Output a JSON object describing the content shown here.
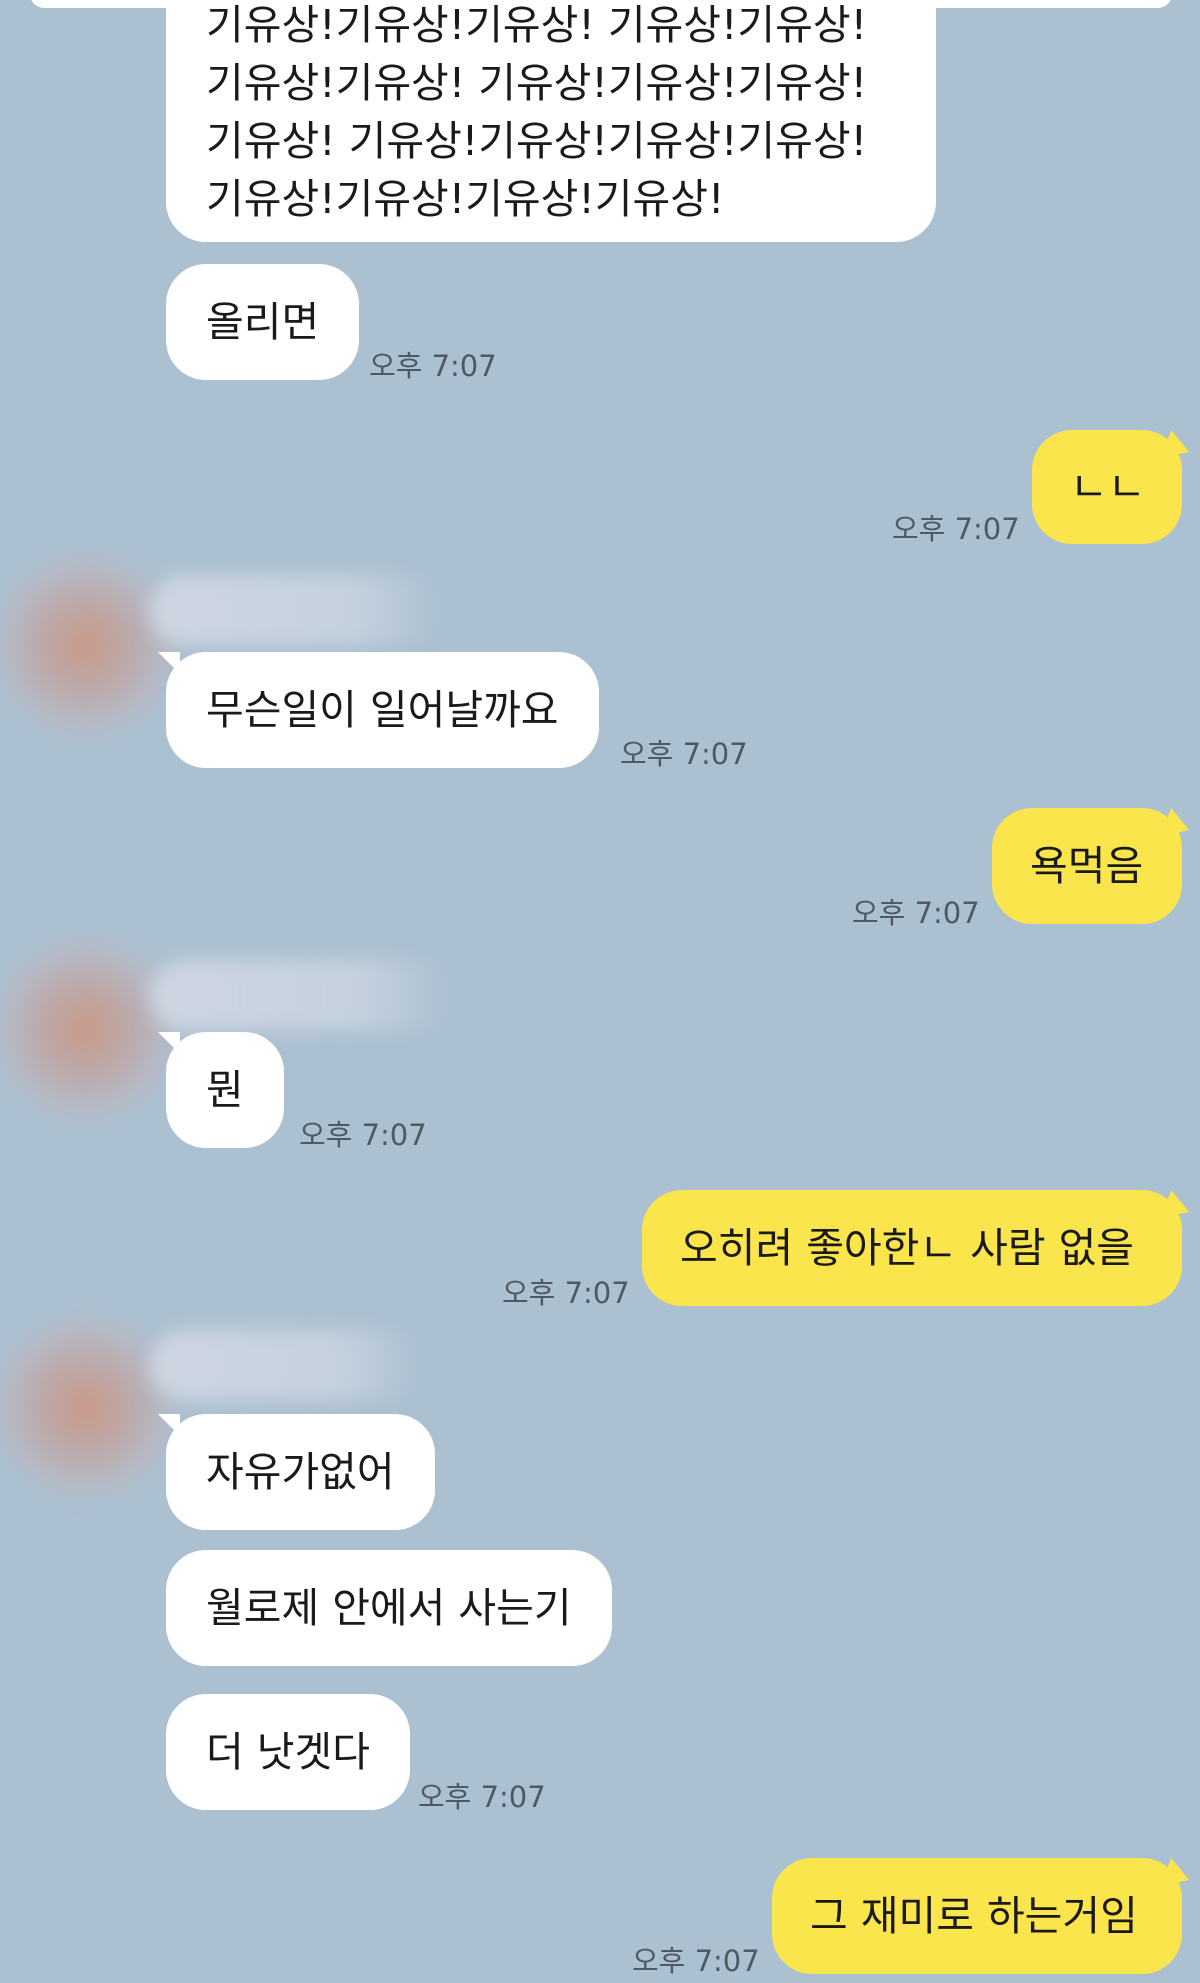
{
  "chat": {
    "messages": [
      {
        "id": "m1",
        "side": "received",
        "lines": [
          "기유상!기유상!기유상! 기유상!기유상!",
          "기유상!기유상! 기유상!기유상!기유상!",
          "기유상! 기유상!기유상!기유상!기유상!",
          "기유상!기유상!기유상!기유상!"
        ]
      },
      {
        "id": "m2",
        "side": "received",
        "text": "올리면",
        "time": "오후 7:07"
      },
      {
        "id": "m3",
        "side": "sent",
        "text": "ㄴㄴ",
        "time": "오후 7:07"
      },
      {
        "id": "m4",
        "side": "received",
        "sender_avatar": "blurred-avatar",
        "sender_name": "blurred-name",
        "text": "무슨일이 일어날까요",
        "time": "오후 7:07"
      },
      {
        "id": "m5",
        "side": "sent",
        "text": "욕먹음",
        "time": "오후 7:07"
      },
      {
        "id": "m6",
        "side": "received",
        "sender_avatar": "blurred-avatar",
        "sender_name": "blurred-name",
        "text": "뭔",
        "time": "오후 7:07"
      },
      {
        "id": "m7",
        "side": "sent",
        "text": "오히려 좋아한ㄴ 사람 없을",
        "time": "오후 7:07"
      },
      {
        "id": "m8",
        "side": "received",
        "sender_avatar": "blurred-avatar",
        "sender_name": "blurred-name",
        "text": "자유가없어"
      },
      {
        "id": "m9",
        "side": "received",
        "text": "월로제 안에서 사는기"
      },
      {
        "id": "m10",
        "side": "received",
        "text": "더 낫겟다",
        "time": "오후 7:07"
      },
      {
        "id": "m11",
        "side": "sent",
        "text": "그 재미로 하는거임",
        "time": "오후 7:07"
      }
    ]
  },
  "colors": {
    "background": "#abc0d1",
    "received_bubble": "#ffffff",
    "sent_bubble": "#fbe54c",
    "timestamp": "#4d5a66"
  }
}
